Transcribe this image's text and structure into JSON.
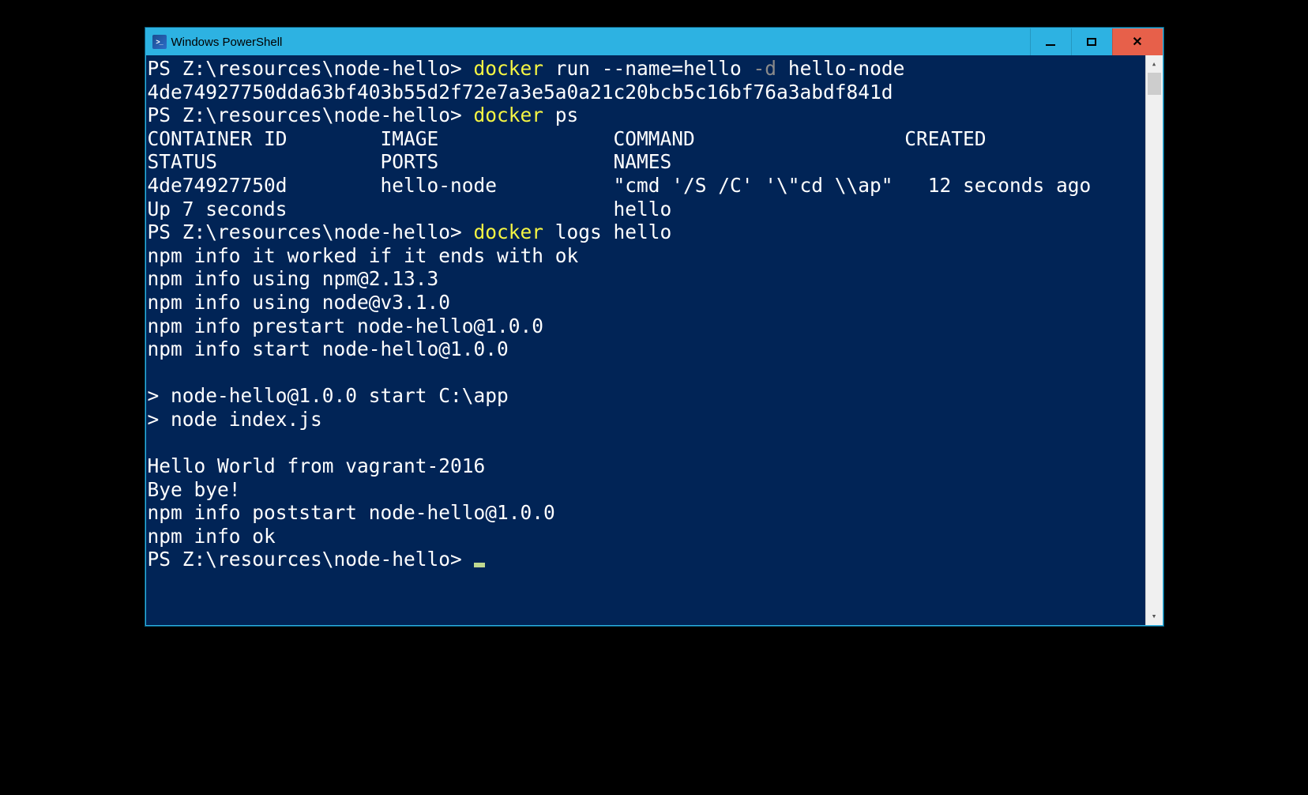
{
  "window": {
    "title": "Windows PowerShell"
  },
  "terminal": {
    "prompt": "PS Z:\\resources\\node-hello>",
    "lines": [
      {
        "t": "cmd",
        "prompt": "PS Z:\\resources\\node-hello> ",
        "cmd": "docker",
        "args_pre": " run --name=hello ",
        "flag": "-d",
        "args_post": " hello-node"
      },
      {
        "t": "out",
        "text": "4de74927750dda63bf403b55d2f72e7a3e5a0a21c20bcb5c16bf76a3abdf841d"
      },
      {
        "t": "cmd",
        "prompt": "PS Z:\\resources\\node-hello> ",
        "cmd": "docker",
        "args_pre": " ps",
        "flag": "",
        "args_post": ""
      },
      {
        "t": "out",
        "text": "CONTAINER ID        IMAGE               COMMAND                  CREATED             STATUS              PORTS               NAMES"
      },
      {
        "t": "out",
        "text": "4de74927750d        hello-node          \"cmd '/S /C' '\\\"cd \\\\ap\"   12 seconds ago      Up 7 seconds                            hello"
      },
      {
        "t": "cmd",
        "prompt": "PS Z:\\resources\\node-hello> ",
        "cmd": "docker",
        "args_pre": " logs hello",
        "flag": "",
        "args_post": ""
      },
      {
        "t": "out",
        "text": "npm info it worked if it ends with ok"
      },
      {
        "t": "out",
        "text": "npm info using npm@2.13.3"
      },
      {
        "t": "out",
        "text": "npm info using node@v3.1.0"
      },
      {
        "t": "out",
        "text": "npm info prestart node-hello@1.0.0"
      },
      {
        "t": "out",
        "text": "npm info start node-hello@1.0.0"
      },
      {
        "t": "out",
        "text": ""
      },
      {
        "t": "out",
        "text": "> node-hello@1.0.0 start C:\\app"
      },
      {
        "t": "out",
        "text": "> node index.js"
      },
      {
        "t": "out",
        "text": ""
      },
      {
        "t": "out",
        "text": "Hello World from vagrant-2016"
      },
      {
        "t": "out",
        "text": "Bye bye!"
      },
      {
        "t": "out",
        "text": "npm info poststart node-hello@1.0.0"
      },
      {
        "t": "out",
        "text": "npm info ok"
      },
      {
        "t": "prompt_cursor",
        "prompt": "PS Z:\\resources\\node-hello> "
      }
    ]
  }
}
